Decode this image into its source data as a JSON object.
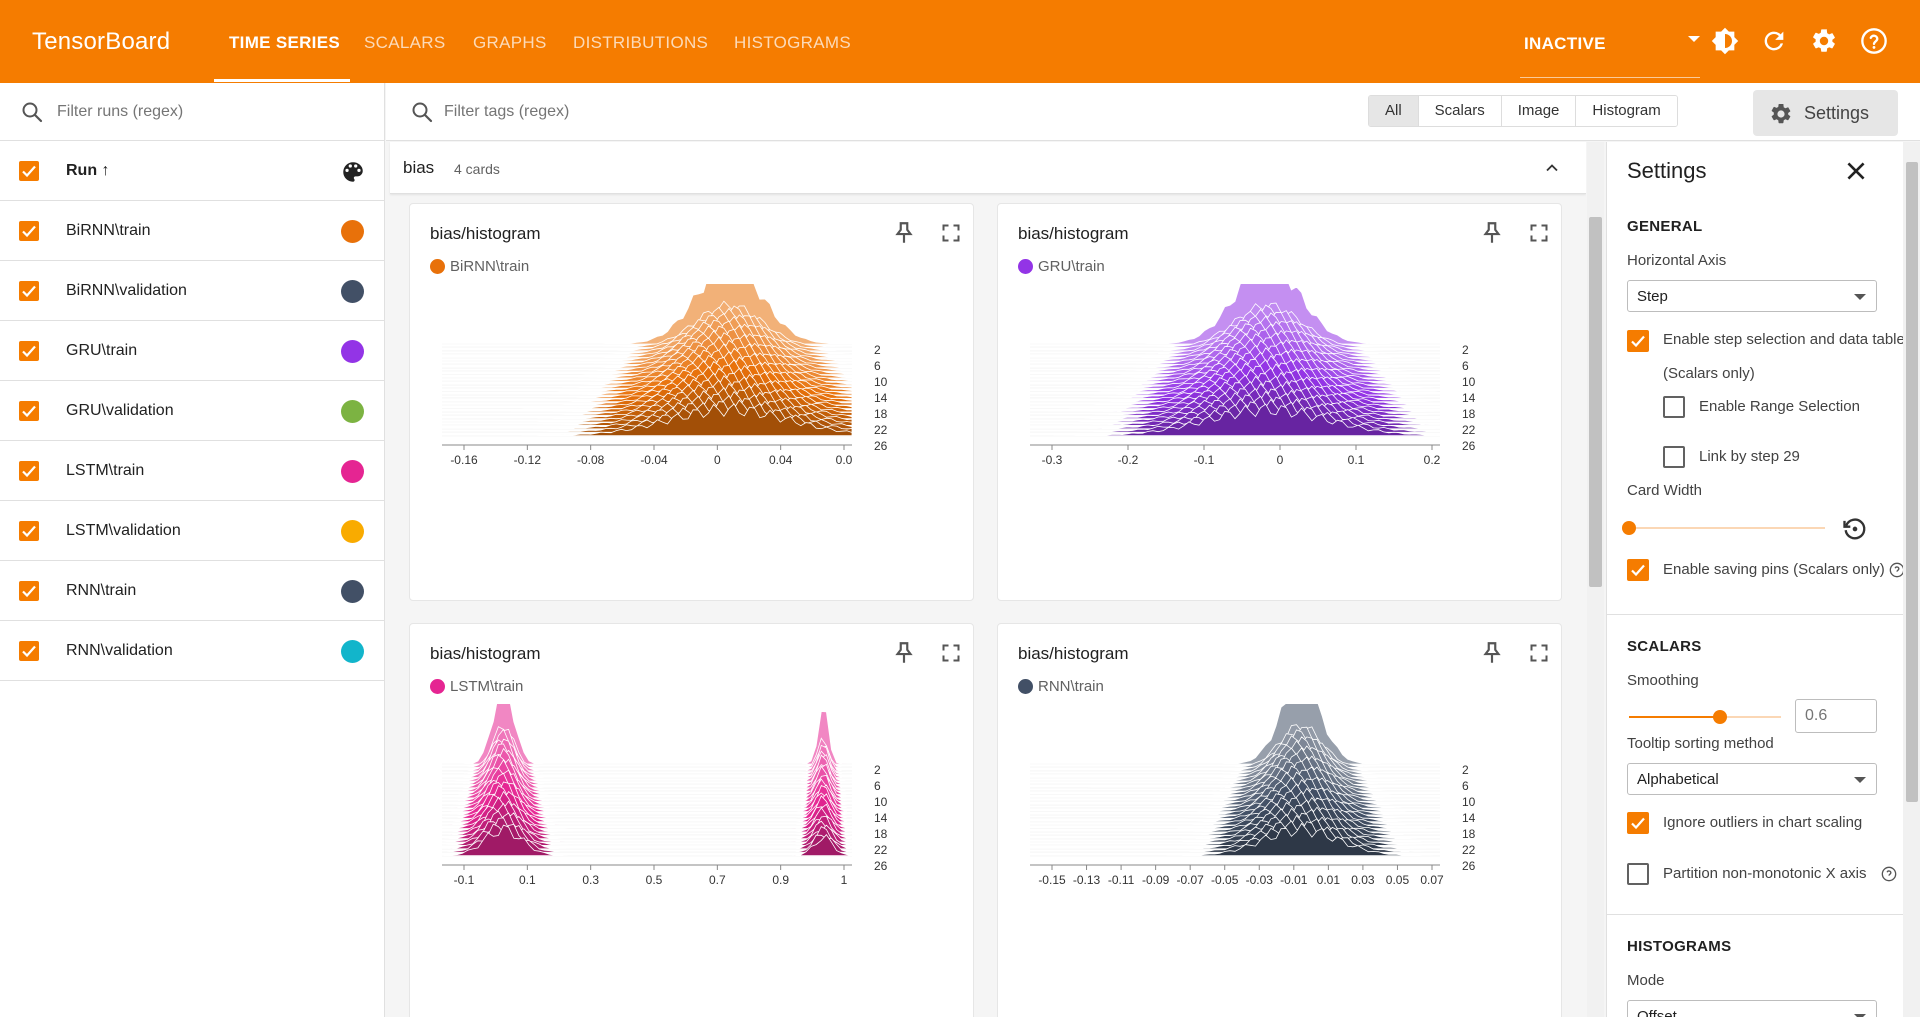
{
  "app": {
    "brand": "TensorBoard",
    "tabs": [
      "TIME SERIES",
      "SCALARS",
      "GRAPHS",
      "DISTRIBUTIONS",
      "HISTOGRAMS"
    ],
    "active_tab": "TIME SERIES",
    "status_select": "INACTIVE",
    "accent": "#f57c00"
  },
  "runs": {
    "filter_placeholder": "Filter runs (regex)",
    "header": "Run ↑",
    "items": [
      {
        "name": "BiRNN\\train",
        "color": "#e8710a"
      },
      {
        "name": "BiRNN\\validation",
        "color": "#425066"
      },
      {
        "name": "GRU\\train",
        "color": "#9334e6"
      },
      {
        "name": "GRU\\validation",
        "color": "#7cb342"
      },
      {
        "name": "LSTM\\train",
        "color": "#e52592"
      },
      {
        "name": "LSTM\\validation",
        "color": "#f9ab00"
      },
      {
        "name": "RNN\\train",
        "color": "#425066"
      },
      {
        "name": "RNN\\validation",
        "color": "#12b5cb"
      }
    ]
  },
  "main": {
    "tag_filter_placeholder": "Filter tags (regex)",
    "type_filters": [
      "All",
      "Scalars",
      "Image",
      "Histogram"
    ],
    "active_type_filter": "All",
    "settings_button": "Settings",
    "group": {
      "name": "bias",
      "count": "4 cards"
    },
    "cards": [
      {
        "title": "bias/histogram",
        "run": "BiRNN\\train",
        "color": "#e8710a",
        "x_ticks": [
          "-0.16",
          "-0.12",
          "-0.08",
          "-0.04",
          "0",
          "0.04",
          "0.0"
        ],
        "step_ticks": [
          "2",
          "6",
          "10",
          "14",
          "18",
          "22",
          "26"
        ]
      },
      {
        "title": "bias/histogram",
        "run": "GRU\\train",
        "color": "#9334e6",
        "x_ticks": [
          "-0.3",
          "-0.2",
          "-0.1",
          "0",
          "0.1",
          "0.2"
        ],
        "step_ticks": [
          "2",
          "6",
          "10",
          "14",
          "18",
          "22",
          "26"
        ]
      },
      {
        "title": "bias/histogram",
        "run": "LSTM\\train",
        "color": "#e52592",
        "x_ticks": [
          "-0.1",
          "0.1",
          "0.3",
          "0.5",
          "0.7",
          "0.9",
          "1"
        ],
        "step_ticks": [
          "2",
          "6",
          "10",
          "14",
          "18",
          "22",
          "26"
        ]
      },
      {
        "title": "bias/histogram",
        "run": "RNN\\train",
        "color": "#425066",
        "x_ticks": [
          "-0.15",
          "-0.13",
          "-0.11",
          "-0.09",
          "-0.07",
          "-0.05",
          "-0.03",
          "-0.01",
          "0.01",
          "0.03",
          "0.05",
          "0.07"
        ],
        "step_ticks": [
          "2",
          "6",
          "10",
          "14",
          "18",
          "22",
          "26"
        ]
      }
    ]
  },
  "settings": {
    "title": "Settings",
    "general": {
      "heading": "GENERAL",
      "horizontal_axis_label": "Horizontal Axis",
      "horizontal_axis_value": "Step",
      "enable_step_selection": "Enable step selection and data table",
      "scalars_only": "(Scalars only)",
      "enable_range_selection": "Enable Range Selection",
      "link_by_step": "Link by step 29",
      "card_width_label": "Card Width",
      "card_width_level": 0,
      "enable_saving_pins": "Enable saving pins (Scalars only)"
    },
    "scalars": {
      "heading": "SCALARS",
      "smoothing_label": "Smoothing",
      "smoothing_value": "0.6",
      "tooltip_sort_label": "Tooltip sorting method",
      "tooltip_sort_value": "Alphabetical",
      "ignore_outliers": "Ignore outliers in chart scaling",
      "partition_non_monotonic": "Partition non-monotonic X axis"
    },
    "histograms": {
      "heading": "HISTOGRAMS",
      "mode_label": "Mode",
      "mode_value": "Offset"
    }
  }
}
